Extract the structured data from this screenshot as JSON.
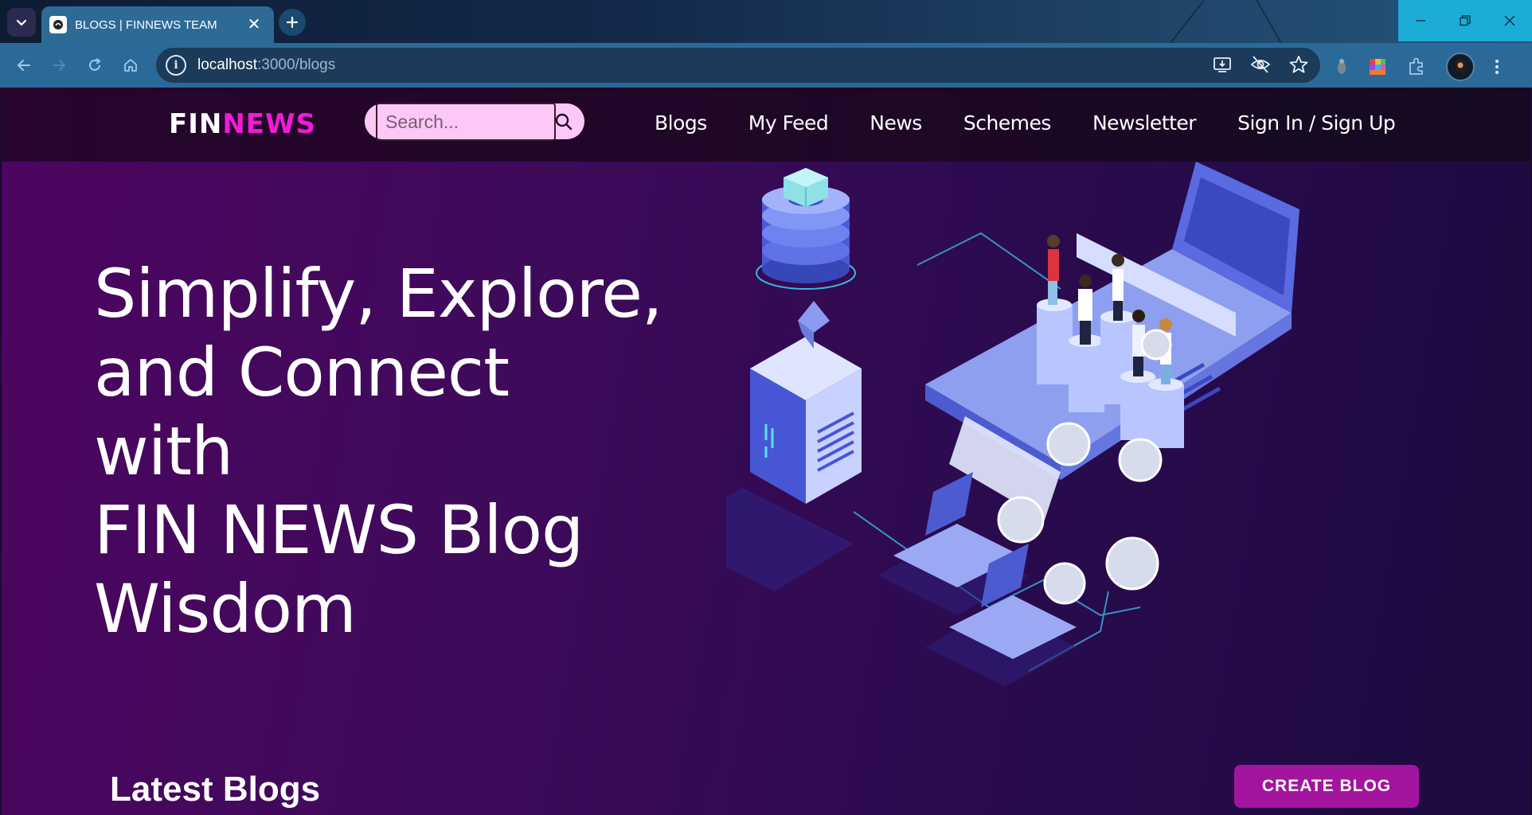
{
  "browser": {
    "tab_title": "BLOGS | FINNEWS TEAM",
    "url_host": "localhost",
    "url_path": ":3000/blogs",
    "close_symbol": "✕",
    "new_tab_symbol": "+"
  },
  "site": {
    "logo_part1": "FIN",
    "logo_part2": "NEWS",
    "search_placeholder": "Search...",
    "nav": [
      {
        "label": "Blogs"
      },
      {
        "label": "My Feed"
      },
      {
        "label": "News"
      },
      {
        "label": "Schemes"
      },
      {
        "label": "Newsletter"
      },
      {
        "label": "Sign In / Sign Up"
      }
    ]
  },
  "hero": {
    "title_line1": "Simplify, Explore,",
    "title_line2": "and Connect with",
    "title_line3": "FIN NEWS Blog",
    "title_line4": "Wisdom"
  },
  "section": {
    "heading": "Latest Blogs",
    "create_button": "CREATE BLOG"
  },
  "colors": {
    "logo_accent": "#f21bd6",
    "search_bg": "#fdc7f7",
    "create_button": "#a3149f",
    "hero_bg": "#4d0560"
  },
  "icons": [
    "tab-search-icon",
    "favicon-icon",
    "close-icon",
    "new-tab-icon",
    "back-icon",
    "forward-icon",
    "reload-icon",
    "home-icon",
    "site-info-icon",
    "install-icon",
    "eye-off-icon",
    "star-icon",
    "extension-icon",
    "search-icon",
    "minimize-icon",
    "restore-icon",
    "window-close-icon"
  ]
}
